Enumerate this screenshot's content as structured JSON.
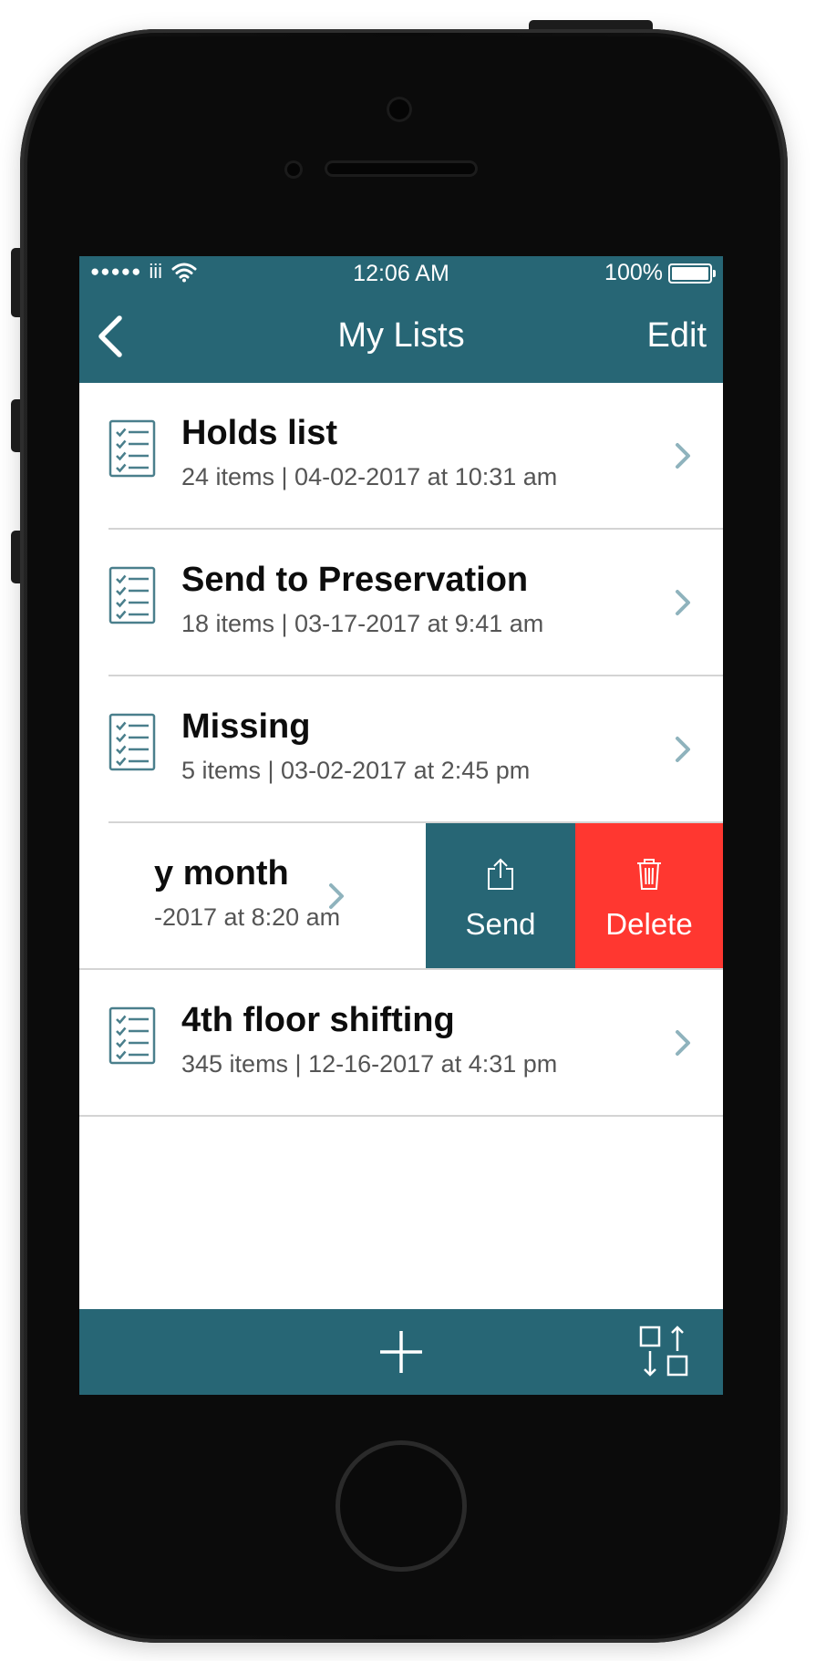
{
  "status_bar": {
    "signal": "●●●●●",
    "carrier": "iii",
    "time": "12:06 AM",
    "battery": "100%"
  },
  "nav": {
    "title": "My Lists",
    "edit_label": "Edit"
  },
  "lists": [
    {
      "title": "Holds list",
      "subtitle": "24 items | 04-02-2017 at 10:31 am"
    },
    {
      "title": "Send to Preservation",
      "subtitle": "18 items | 03-17-2017 at 9:41 am"
    },
    {
      "title": "Missing",
      "subtitle": "5 items | 03-02-2017 at 2:45 pm"
    },
    {
      "title": "y month",
      "subtitle": "-2017 at 8:20 am"
    },
    {
      "title": "4th floor shifting",
      "subtitle": "345 items | 12-16-2017 at 4:31 pm"
    }
  ],
  "swipe_actions": {
    "send_label": "Send",
    "delete_label": "Delete"
  },
  "colors": {
    "brand": "#276675",
    "delete": "#ff3730",
    "icon": "#4a7f8c",
    "chevron": "#8fb3bd"
  },
  "icons": {
    "list": "checklist-icon",
    "chevron": "chevron-right-icon",
    "send": "share-icon",
    "delete": "trash-icon",
    "add": "plus-icon",
    "sort": "sort-arrows-icon"
  }
}
